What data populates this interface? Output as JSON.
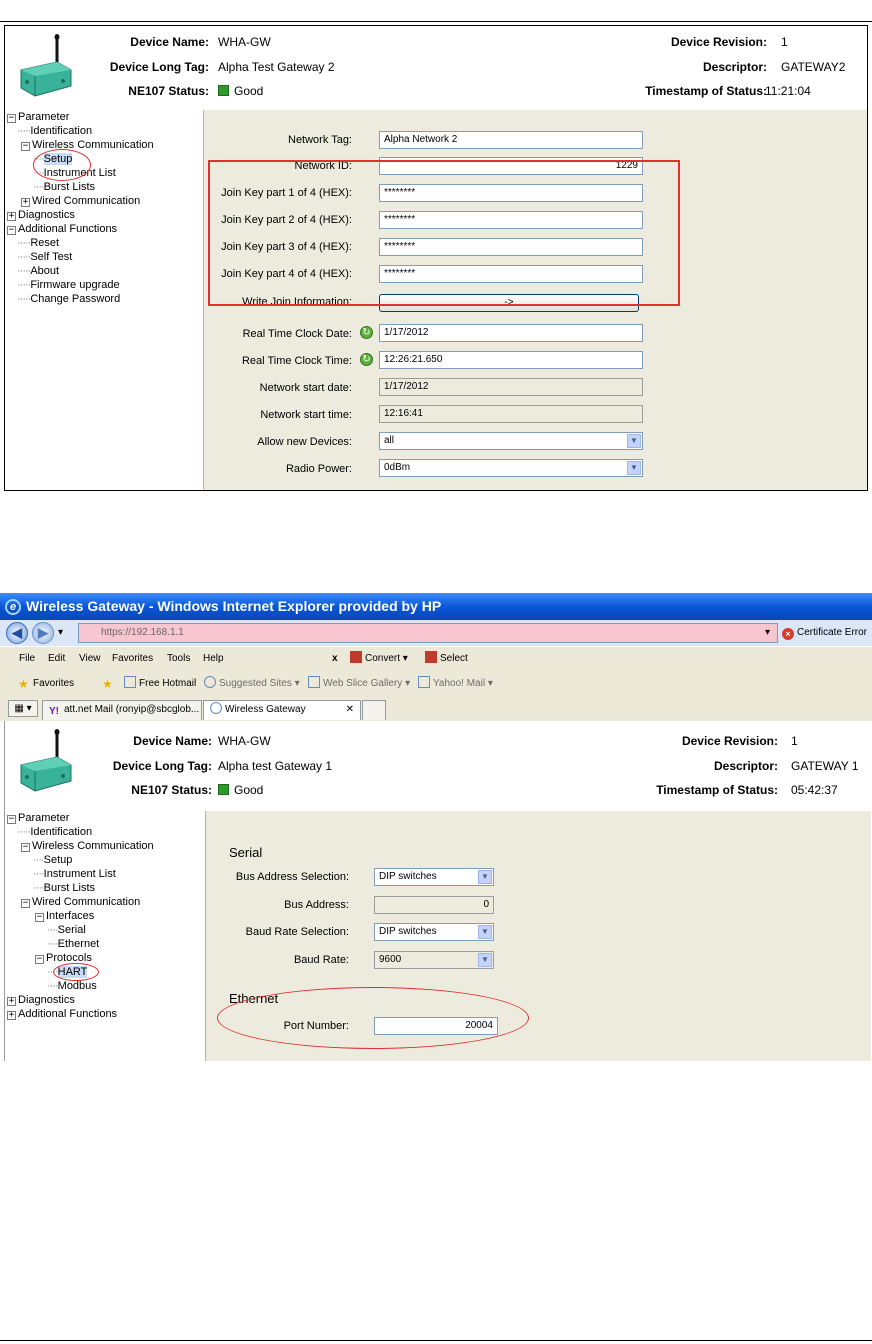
{
  "panel_top": {
    "header": {
      "device_name_label": "Device Name:",
      "device_name": "WHA-GW",
      "long_tag_label": "Device Long Tag:",
      "long_tag": "Alpha Test Gateway 2",
      "ne107_label": "NE107 Status:",
      "ne107_status": "Good",
      "revision_label": "Device Revision:",
      "revision": "1",
      "descriptor_label": "Descriptor:",
      "descriptor": "GATEWAY2",
      "timestamp_label": "Timestamp of Status:",
      "timestamp": "11:21:04"
    },
    "tree": [
      {
        "label": "Parameter",
        "expander": "−"
      },
      {
        "label": "Identification"
      },
      {
        "label": "Wireless Communication",
        "expander": "−"
      },
      {
        "label": "Setup",
        "selected": true
      },
      {
        "label": "Instrument List"
      },
      {
        "label": "Burst Lists"
      },
      {
        "label": "Wired Communication",
        "expander": "+"
      },
      {
        "label": "Diagnostics",
        "expander": "+"
      },
      {
        "label": "Additional Functions",
        "expander": "−"
      },
      {
        "label": "Reset"
      },
      {
        "label": "Self Test"
      },
      {
        "label": "About"
      },
      {
        "label": "Firmware upgrade"
      },
      {
        "label": "Change Password"
      }
    ],
    "fields": {
      "network_tag_label": "Network Tag:",
      "network_tag": "Alpha Network 2",
      "network_id_label": "Network ID:",
      "network_id": "1229",
      "join1_label": "Join Key part 1 of 4 (HEX):",
      "join1": "********",
      "join2_label": "Join Key part 2 of 4 (HEX):",
      "join2": "********",
      "join3_label": "Join Key part 3 of 4 (HEX):",
      "join3": "********",
      "join4_label": "Join Key part 4 of 4 (HEX):",
      "join4": "********",
      "write_join_label": "Write Join Information:",
      "write_join_button": "->",
      "rtc_date_label": "Real Time Clock Date:",
      "rtc_date": "1/17/2012",
      "rtc_time_label": "Real Time Clock Time:",
      "rtc_time": "12:26:21.650",
      "net_start_date_label": "Network start date:",
      "net_start_date": "1/17/2012",
      "net_start_time_label": "Network start time:",
      "net_start_time": "12:16:41",
      "allow_devices_label": "Allow new Devices:",
      "allow_devices": "all",
      "radio_power_label": "Radio Power:",
      "radio_power": "0dBm"
    }
  },
  "browser": {
    "title": "Wireless Gateway - Windows Internet Explorer provided by HP",
    "address": "https://192.168.1.1",
    "certificate_error": "Certificate Error",
    "menu": [
      "File",
      "Edit",
      "View",
      "Favorites",
      "Tools",
      "Help"
    ],
    "convert": "Convert",
    "select": "Select",
    "favorites": "Favorites",
    "fav_links": [
      "Free Hotmail",
      "Suggested Sites",
      "Web Slice Gallery",
      "Yahoo! Mail"
    ],
    "tabs": [
      "att.net Mail (ronyip@sbcglob...",
      "Wireless Gateway"
    ]
  },
  "panel_bottom": {
    "header": {
      "device_name_label": "Device Name:",
      "device_name": "WHA-GW",
      "long_tag_label": "Device Long Tag:",
      "long_tag": "Alpha test Gateway 1",
      "ne107_label": "NE107 Status:",
      "ne107_status": "Good",
      "revision_label": "Device Revision:",
      "revision": "1",
      "descriptor_label": "Descriptor:",
      "descriptor": "GATEWAY 1",
      "timestamp_label": "Timestamp of Status:",
      "timestamp": "05:42:37"
    },
    "tree": [
      {
        "label": "Parameter",
        "expander": "−"
      },
      {
        "label": "Identification"
      },
      {
        "label": "Wireless Communication",
        "expander": "−"
      },
      {
        "label": "Setup"
      },
      {
        "label": "Instrument List"
      },
      {
        "label": "Burst Lists"
      },
      {
        "label": "Wired Communication",
        "expander": "−"
      },
      {
        "label": "Interfaces",
        "expander": "−"
      },
      {
        "label": "Serial"
      },
      {
        "label": "Ethernet"
      },
      {
        "label": "Protocols",
        "expander": "−"
      },
      {
        "label": "HART",
        "selected": true
      },
      {
        "label": "Modbus"
      },
      {
        "label": "Diagnostics",
        "expander": "+"
      },
      {
        "label": "Additional Functions",
        "expander": "+"
      }
    ],
    "fields": {
      "serial_heading": "Serial",
      "bus_addr_sel_label": "Bus Address Selection:",
      "bus_addr_sel": "DIP switches",
      "bus_addr_label": "Bus Address:",
      "bus_addr": "0",
      "baud_sel_label": "Baud Rate Selection:",
      "baud_sel": "DIP switches",
      "baud_label": "Baud Rate:",
      "baud": "9600",
      "ethernet_heading": "Ethernet",
      "port_label": "Port Number:",
      "port": "20004"
    }
  }
}
